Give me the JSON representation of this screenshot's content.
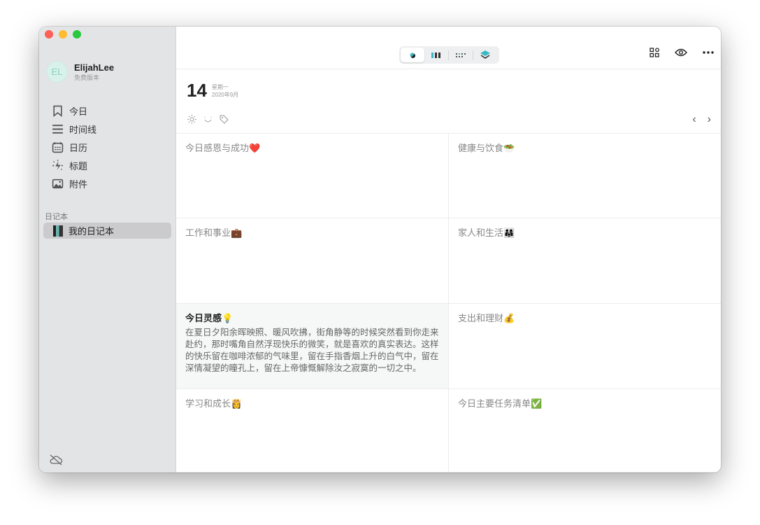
{
  "user": {
    "initials": "EL",
    "name": "ElijahLee",
    "plan": "免费版本"
  },
  "nav": [
    {
      "label": "今日",
      "icon": "bookmark-icon"
    },
    {
      "label": "时间线",
      "icon": "menu-icon"
    },
    {
      "label": "日历",
      "icon": "calendar-icon"
    },
    {
      "label": "标题",
      "icon": "sparkle-icon"
    },
    {
      "label": "附件",
      "icon": "image-icon"
    }
  ],
  "notebooks": {
    "section": "日记本",
    "items": [
      {
        "label": "我的日记本"
      }
    ]
  },
  "date": {
    "day": "14",
    "weekday": "星期一",
    "month": "2020年9月"
  },
  "accent": "#3ab8c4",
  "cells": [
    {
      "title": "今日感恩与成功❤️"
    },
    {
      "title": "健康与饮食🥗"
    },
    {
      "title": "工作和事业💼"
    },
    {
      "title": "家人和生活👨‍👩‍👧"
    },
    {
      "title": "今日灵感💡",
      "body": "在夏日夕阳余晖映照、暖风吹拂，街角静等的时候突然看到你走来赴约，那时嘴角自然浮现快乐的微笑，就是喜欢的真实表达。这样的快乐留在咖啡浓郁的气味里，留在手指香烟上升的白气中，留在深情凝望的瞳孔上，留在上帝慷慨解除汝之寂寞的一切之中。"
    },
    {
      "title": "支出和理财💰"
    },
    {
      "title": "学习和成长👸"
    },
    {
      "title": "今日主要任务清单✅"
    }
  ]
}
